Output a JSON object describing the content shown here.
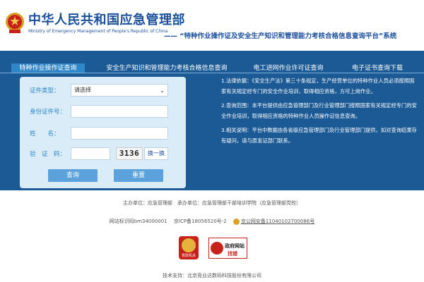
{
  "header": {
    "ministry_cn": "中华人民共和国应急管理部",
    "ministry_en": "Ministry of Emergency Management of People's Republic of China",
    "system_title": "—— “特种作业操作证及安全生产知识和管理能力考核合格信息查询平台”系统"
  },
  "tabs": [
    {
      "label": "特种作业操作证查询",
      "active": true
    },
    {
      "label": "安全生产知识和管理能力考核合格信息查询",
      "active": false
    },
    {
      "label": "电工进网作业许可证查询",
      "active": false
    },
    {
      "label": "电子证书查询下载",
      "active": false
    }
  ],
  "form": {
    "cert_type_label": "证件类型：",
    "cert_type_value": "请选择",
    "id_label": "身份证件号：",
    "id_value": "",
    "name_label": "姓　　名：",
    "name_value": "",
    "captcha_label": "验　证　码：",
    "captcha_value": "",
    "captcha_text": "3136",
    "refresh_label": "换一换",
    "query_button": "查询",
    "reset_button": "重置"
  },
  "info": {
    "p1": "1.法律依据：《安全生产法》第三十条规定，生产经营单位的特种作业人员必须按照国家有关规定经专门的安全作业培训，取得相应资格，方可上岗作业。",
    "p2": "2.查询范围：本平台提供由应急管理部门及行业管理部门按照国家有关规定经专门的安全作业培训，取得相应资格的特种作业人员操作证信息查询。",
    "p3": "3.相关说明：平台中数据由各省级应急管理部门及行业管理部门提供，如对查询结果存有疑问，请与原发证部门联系。"
  },
  "footer": {
    "sponsor": "主办单位：应急管理部　承办单位：应急管理部干部培训学院（应急管理部党校）",
    "site_id": "网站标识码bm34000001",
    "icp": "京ICP备18056520号-2",
    "police": "京公网安备11040102700086号",
    "party_badge": "党政机关",
    "gov_site_1": "政府网站",
    "gov_site_2": "找错",
    "tech": "技术支持：北京竞业达数码科技股份有限公司"
  },
  "colors": {
    "brand_blue": "#1b4f9c",
    "band_blue": "#1c5a95",
    "active_tab": "#2f86c8",
    "button": "#5ba2dc",
    "form_bg": "#d9ecf8"
  }
}
